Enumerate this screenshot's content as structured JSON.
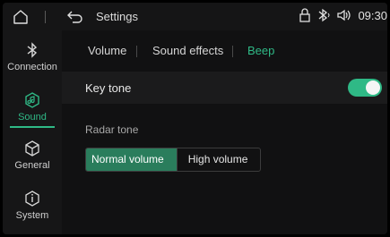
{
  "statusbar": {
    "title": "Settings",
    "time": "09:30",
    "icons": [
      "home-icon",
      "back-icon",
      "lock-icon",
      "bluetooth-icon",
      "volume-icon"
    ]
  },
  "sidebar": {
    "items": [
      {
        "label": "Connection",
        "icon": "bluetooth-icon",
        "active": false
      },
      {
        "label": "Sound",
        "icon": "sound-icon",
        "active": true
      },
      {
        "label": "General",
        "icon": "cube-icon",
        "active": false
      },
      {
        "label": "System",
        "icon": "info-icon",
        "active": false
      }
    ]
  },
  "tabs": [
    {
      "label": "Volume",
      "active": false
    },
    {
      "label": "Sound effects",
      "active": false
    },
    {
      "label": "Beep",
      "active": true
    }
  ],
  "key_tone": {
    "label": "Key tone",
    "enabled": true
  },
  "radar_tone": {
    "label": "Radar tone",
    "options": [
      "Normal volume",
      "High volume"
    ],
    "selected": "Normal volume"
  },
  "colors": {
    "accent": "#2fb986",
    "selected_bg": "#2a7d5c"
  }
}
